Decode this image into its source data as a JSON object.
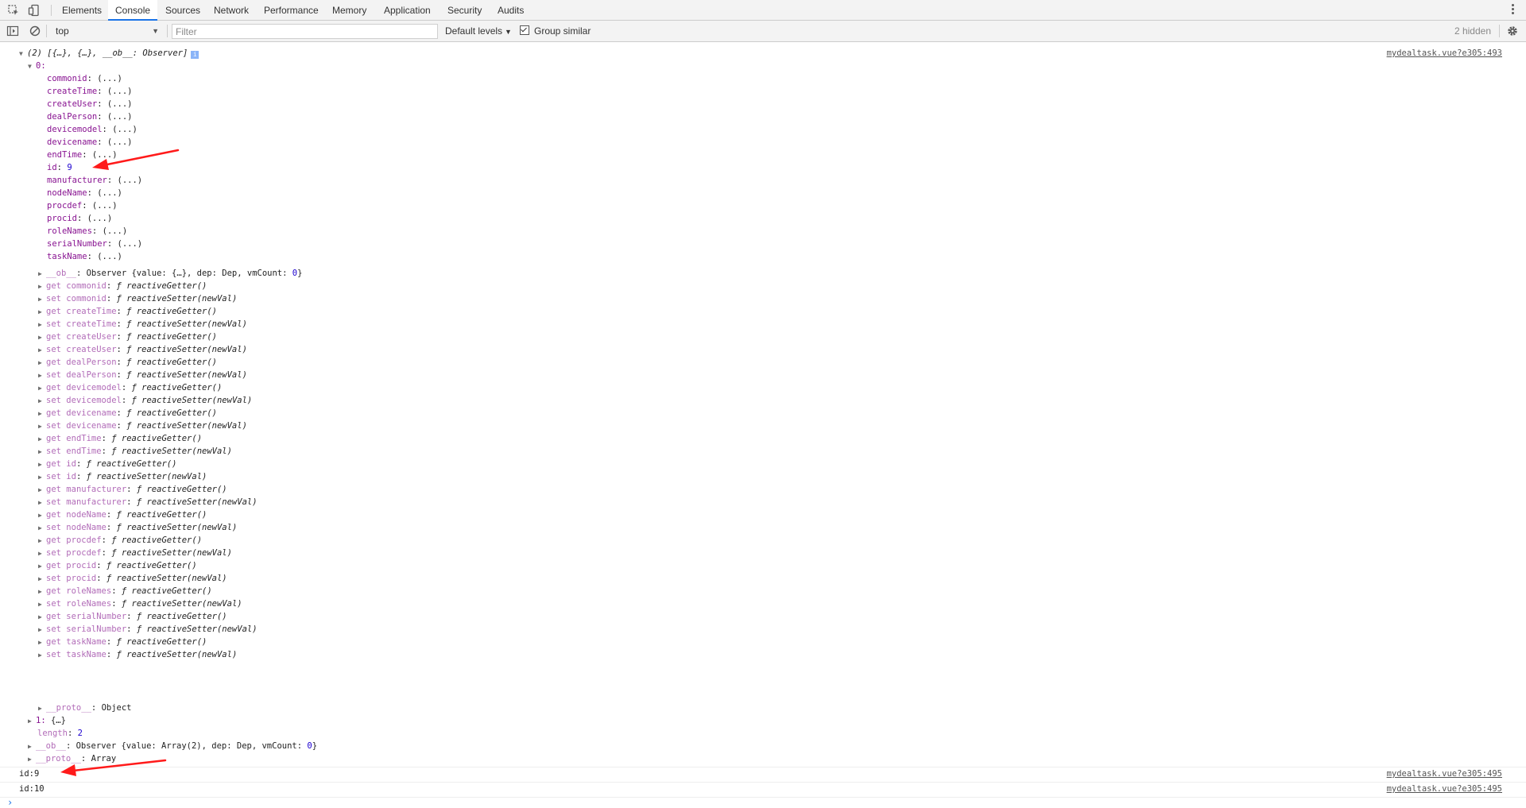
{
  "tabs": [
    "Elements",
    "Console",
    "Sources",
    "Network",
    "Performance",
    "Memory",
    "Application",
    "Security",
    "Audits"
  ],
  "toolbar": {
    "context": "top",
    "filter_placeholder": "Filter",
    "levels_label": "Default levels",
    "group_similar_label": "Group similar",
    "hidden_count": "2 hidden"
  },
  "icons": {
    "inspect": "inspect-element-icon",
    "device": "device-toolbar-icon",
    "sidebar": "console-sidebar-icon",
    "clear": "clear-console-icon",
    "settings": "gear-icon",
    "menu": "kebab-menu-icon"
  },
  "colors": {
    "accent": "#1a73e8",
    "key": "#881391",
    "number": "#1c00cf",
    "arrow": "#ff1a1a"
  },
  "console": {
    "header": "(2) [{…}, {…}, __ob__: Observer]",
    "header_src": "mydealtask.vue?e305:493",
    "item0_label": "0:",
    "props": [
      {
        "key": "commonid",
        "value": "(...)"
      },
      {
        "key": "createTime",
        "value": "(...)"
      },
      {
        "key": "createUser",
        "value": "(...)"
      },
      {
        "key": "dealPerson",
        "value": "(...)"
      },
      {
        "key": "devicemodel",
        "value": "(...)"
      },
      {
        "key": "devicename",
        "value": "(...)"
      },
      {
        "key": "endTime",
        "value": "(...)"
      },
      {
        "key": "id",
        "value": "9"
      },
      {
        "key": "manufacturer",
        "value": "(...)"
      },
      {
        "key": "nodeName",
        "value": "(...)"
      },
      {
        "key": "procdef",
        "value": "(...)"
      },
      {
        "key": "procid",
        "value": "(...)"
      },
      {
        "key": "roleNames",
        "value": "(...)"
      },
      {
        "key": "serialNumber",
        "value": "(...)"
      },
      {
        "key": "taskName",
        "value": "(...)"
      }
    ],
    "ob_line": {
      "key": "__ob__",
      "prefix": "Observer {value: {…}, dep: Dep, vmCount: ",
      "count": "0",
      "suffix": "}"
    },
    "accessors": [
      {
        "kind": "get",
        "key": "commonid",
        "fn": "reactiveGetter()"
      },
      {
        "kind": "set",
        "key": "commonid",
        "fn": "reactiveSetter(newVal)"
      },
      {
        "kind": "get",
        "key": "createTime",
        "fn": "reactiveGetter()"
      },
      {
        "kind": "set",
        "key": "createTime",
        "fn": "reactiveSetter(newVal)"
      },
      {
        "kind": "get",
        "key": "createUser",
        "fn": "reactiveGetter()"
      },
      {
        "kind": "set",
        "key": "createUser",
        "fn": "reactiveSetter(newVal)"
      },
      {
        "kind": "get",
        "key": "dealPerson",
        "fn": "reactiveGetter()"
      },
      {
        "kind": "set",
        "key": "dealPerson",
        "fn": "reactiveSetter(newVal)"
      },
      {
        "kind": "get",
        "key": "devicemodel",
        "fn": "reactiveGetter()"
      },
      {
        "kind": "set",
        "key": "devicemodel",
        "fn": "reactiveSetter(newVal)"
      },
      {
        "kind": "get",
        "key": "devicename",
        "fn": "reactiveGetter()"
      },
      {
        "kind": "set",
        "key": "devicename",
        "fn": "reactiveSetter(newVal)"
      },
      {
        "kind": "get",
        "key": "endTime",
        "fn": "reactiveGetter()"
      },
      {
        "kind": "set",
        "key": "endTime",
        "fn": "reactiveSetter(newVal)"
      },
      {
        "kind": "get",
        "key": "id",
        "fn": "reactiveGetter()"
      },
      {
        "kind": "set",
        "key": "id",
        "fn": "reactiveSetter(newVal)"
      },
      {
        "kind": "get",
        "key": "manufacturer",
        "fn": "reactiveGetter()"
      },
      {
        "kind": "set",
        "key": "manufacturer",
        "fn": "reactiveSetter(newVal)"
      },
      {
        "kind": "get",
        "key": "nodeName",
        "fn": "reactiveGetter()"
      },
      {
        "kind": "set",
        "key": "nodeName",
        "fn": "reactiveSetter(newVal)"
      },
      {
        "kind": "get",
        "key": "procdef",
        "fn": "reactiveGetter()"
      },
      {
        "kind": "set",
        "key": "procdef",
        "fn": "reactiveSetter(newVal)"
      },
      {
        "kind": "get",
        "key": "procid",
        "fn": "reactiveGetter()"
      },
      {
        "kind": "set",
        "key": "procid",
        "fn": "reactiveSetter(newVal)"
      },
      {
        "kind": "get",
        "key": "roleNames",
        "fn": "reactiveGetter()"
      },
      {
        "kind": "set",
        "key": "roleNames",
        "fn": "reactiveSetter(newVal)"
      },
      {
        "kind": "get",
        "key": "serialNumber",
        "fn": "reactiveGetter()"
      },
      {
        "kind": "set",
        "key": "serialNumber",
        "fn": "reactiveSetter(newVal)"
      },
      {
        "kind": "get",
        "key": "taskName",
        "fn": "reactiveGetter()"
      },
      {
        "kind": "set",
        "key": "taskName",
        "fn": "reactiveSetter(newVal)"
      }
    ],
    "proto0": {
      "key": "__proto__",
      "value": "Object"
    },
    "item1": {
      "key": "1",
      "value": "{…}"
    },
    "length": {
      "key": "length",
      "value": "2"
    },
    "ob_array": {
      "key": "__ob__",
      "prefix": "Observer {value: Array(2), dep: Dep, vmCount: ",
      "count": "0",
      "suffix": "}"
    },
    "proto_array": {
      "key": "__proto__",
      "value": "Array"
    },
    "logs": [
      {
        "text": "id:9",
        "src": "mydealtask.vue?e305:495"
      },
      {
        "text": "id:10",
        "src": "mydealtask.vue?e305:495"
      }
    ],
    "prompt": "›"
  }
}
